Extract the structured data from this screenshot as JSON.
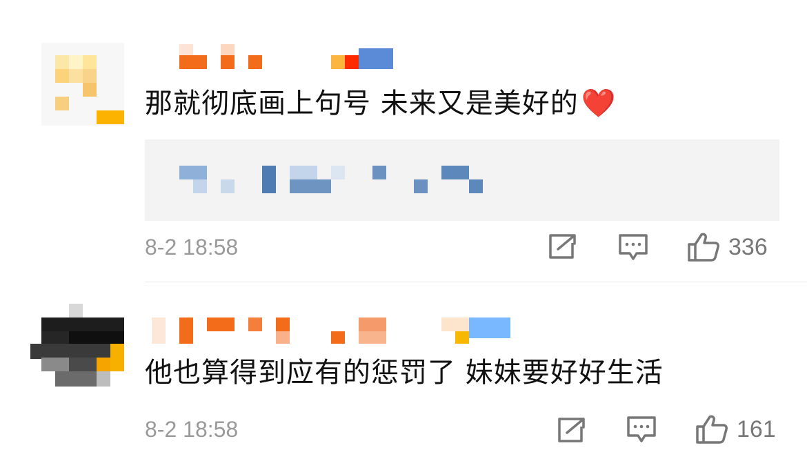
{
  "comments": [
    {
      "text": "那就彻底画上句号 未来又是美好的",
      "emoji": "❤️",
      "time": "8-2 18:58",
      "likes": "336",
      "icons": {
        "share": "share-icon",
        "reply": "comment-icon",
        "like": "thumbs-up-icon"
      }
    },
    {
      "text": "他也算得到应有的惩罚了 妹妹要好好生活",
      "time": "8-2 18:58",
      "likes": "161",
      "icons": {
        "share": "share-icon",
        "reply": "comment-icon",
        "like": "thumbs-up-icon"
      }
    }
  ],
  "colors": {
    "text": "#111111",
    "meta": "#999999",
    "heart": "#e0232a",
    "quote_bg": "#f3f3f3",
    "username_orange": "#f26c1a",
    "quote_blue": "#4f7db3"
  }
}
